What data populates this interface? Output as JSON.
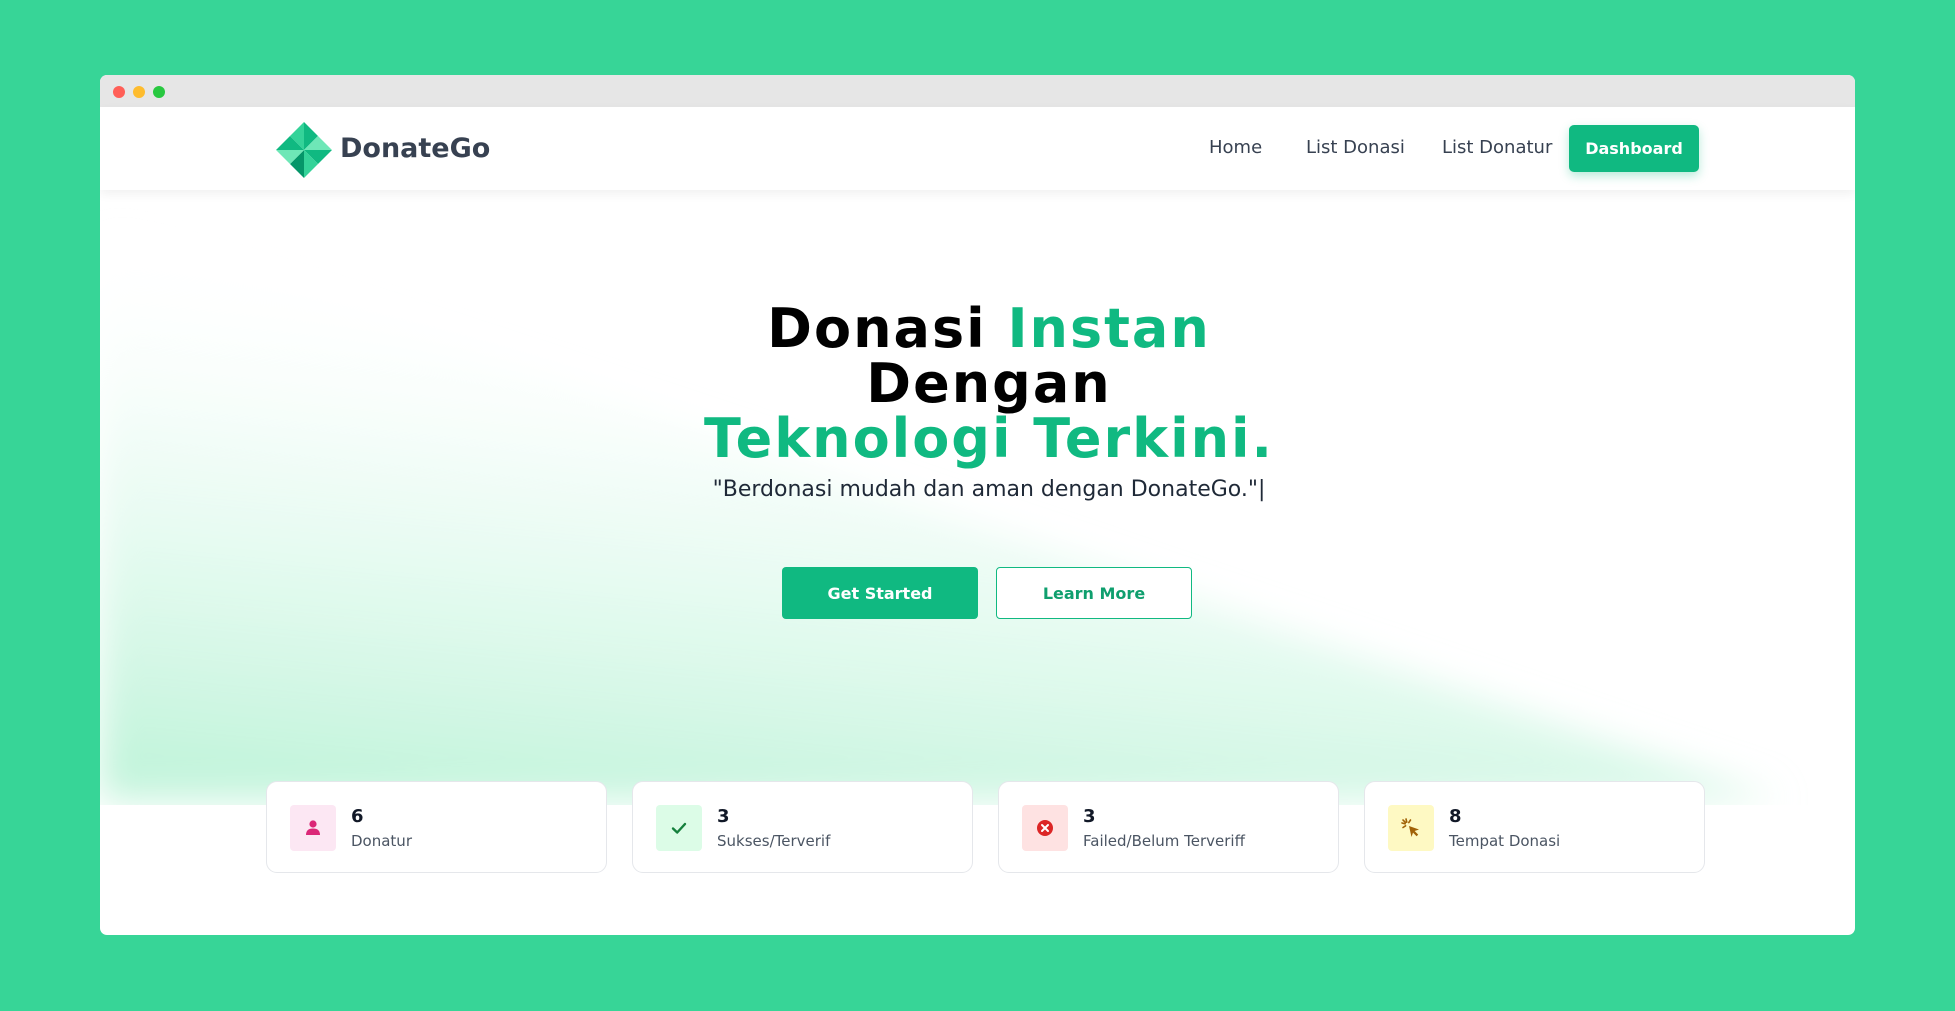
{
  "window": {
    "controls": [
      "close",
      "minimize",
      "maximize"
    ]
  },
  "navbar": {
    "brand": "DonateGo",
    "logo_icon": "pinwheel-logo-icon",
    "links": {
      "home": "Home",
      "list_donasi": "List Donasi",
      "list_donatur": "List Donatur"
    },
    "dashboard_label": "Dashboard"
  },
  "hero": {
    "title": {
      "part1": "Donasi ",
      "part2": "Instan",
      "part3": "Dengan",
      "part4": "Teknologi Terkini."
    },
    "subtitle": "\"Berdonasi mudah dan aman dengan DonateGo.\"|",
    "buttons": {
      "get_started": "Get Started",
      "learn_more": "Learn More"
    }
  },
  "stats": [
    {
      "value": "6",
      "label": "Donatur",
      "icon": "user-icon",
      "icon_bg": "#fce7f3",
      "icon_color": "#db2777"
    },
    {
      "value": "3",
      "label": "Sukses/Terverif",
      "icon": "check-icon",
      "icon_bg": "#dcfce7",
      "icon_color": "#15803d"
    },
    {
      "value": "3",
      "label": "Failed/Belum Terveriff",
      "icon": "x-circle-icon",
      "icon_bg": "#fee2e2",
      "icon_color": "#dc2626"
    },
    {
      "value": "8",
      "label": "Tempat Donasi",
      "icon": "cursor-click-icon",
      "icon_bg": "#fef9c3",
      "icon_color": "#a16207"
    }
  ],
  "colors": {
    "page_background": "#37d597",
    "accent": "#10b981",
    "text_dark": "#374151"
  }
}
